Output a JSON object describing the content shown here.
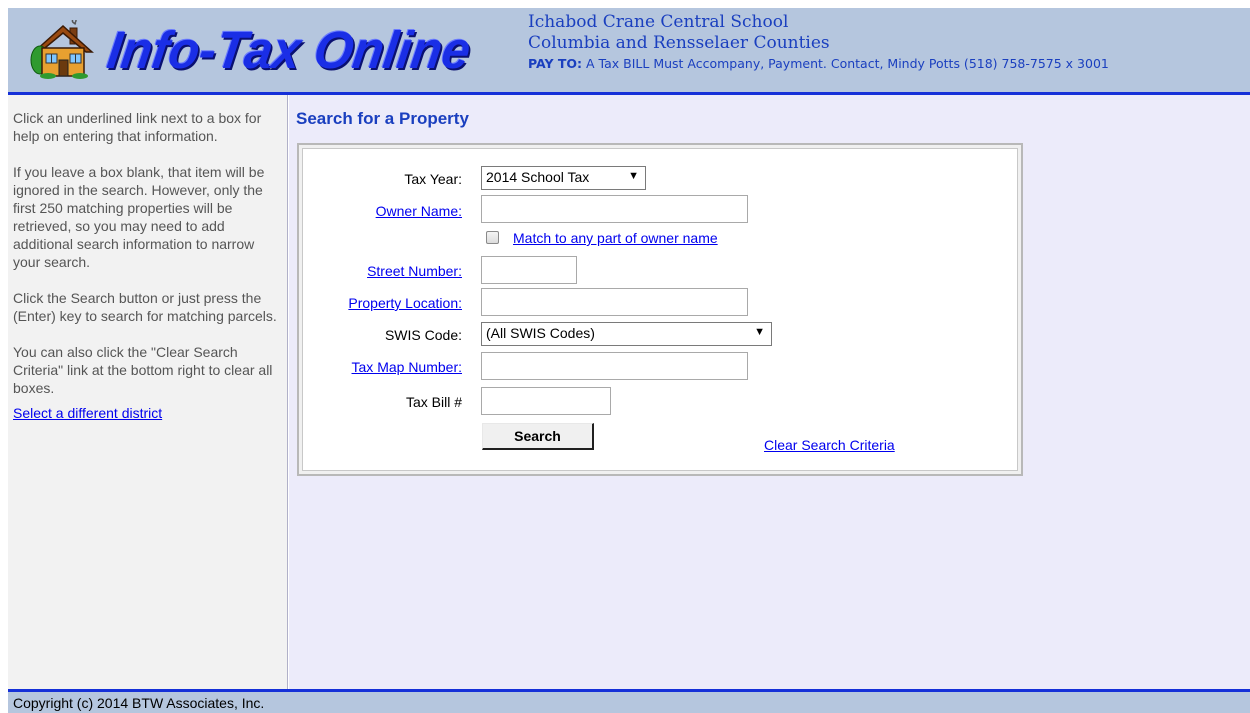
{
  "header": {
    "logo_text": "Info-Tax Online",
    "district_line1": "Ichabod Crane Central School",
    "district_line2": "Columbia and Rensselaer Counties",
    "payto_label": "PAY TO:",
    "payto_text": "A Tax BILL Must Accompany, Payment. Contact, Mindy Potts (518) 758-7575 x 3001"
  },
  "sidebar": {
    "help1": "Click an underlined link next to a box for help on entering that information.",
    "help2": "If you leave a box blank, that item will be ignored in the search. However, only the first 250 matching properties will be retrieved, so you may need to add additional search information to narrow your search.",
    "help3": "Click the Search button or just press the (Enter) key to search for matching parcels.",
    "help4": "You can also click the \"Clear Search Criteria\" link at the bottom right to clear all boxes.",
    "district_link": "Select a different district"
  },
  "main": {
    "title": "Search for a Property"
  },
  "form": {
    "tax_year_label": "Tax Year:",
    "tax_year_value": "2014 School Tax",
    "owner_name_label": "Owner Name:",
    "owner_name_value": "",
    "match_label": "Match to any part of owner name",
    "match_checked": false,
    "street_number_label": "Street Number:",
    "property_location_label": "Property Location:",
    "swis_label": "SWIS Code:",
    "swis_value": "(All SWIS Codes)",
    "tax_map_label": "Tax Map Number:",
    "tax_bill_label": "Tax Bill #",
    "search_button": "Search",
    "clear_link": "Clear Search Criteria"
  },
  "footer": {
    "copyright": "Copyright (c) 2014 BTW Associates, Inc."
  },
  "colors": {
    "header_bg": "#b5c6de",
    "accent_blue": "#1530d8",
    "link": "#0000ee",
    "main_bg": "#ecebfa"
  }
}
